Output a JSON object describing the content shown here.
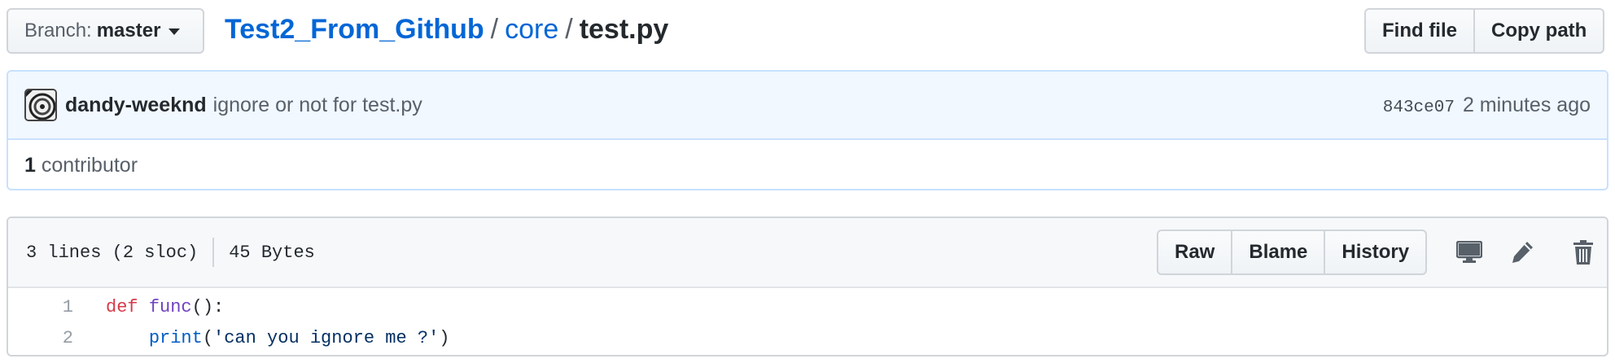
{
  "branch": {
    "prefix": "Branch:",
    "name": "master"
  },
  "breadcrumb": {
    "repo": "Test2_From_Github",
    "sep1": "/",
    "dir": "core",
    "sep2": "/",
    "file": "test.py"
  },
  "top_actions": {
    "find_file": "Find file",
    "copy_path": "Copy path"
  },
  "commit": {
    "author": "dandy-weeknd",
    "message": "ignore or not for test.py",
    "sha": "843ce07",
    "time": "2 minutes ago"
  },
  "contributors": {
    "count": "1",
    "label": "contributor"
  },
  "file": {
    "lines_info": "3 lines (2 sloc)",
    "size": "45 Bytes",
    "actions": {
      "raw": "Raw",
      "blame": "Blame",
      "history": "History"
    },
    "icons": [
      "desktop-icon",
      "pencil-icon",
      "trash-icon"
    ]
  },
  "code": {
    "lines": [
      {
        "num": "1",
        "tokens": [
          {
            "t": "def",
            "c": "kw"
          },
          {
            "t": " ",
            "c": ""
          },
          {
            "t": "func",
            "c": "fn"
          },
          {
            "t": "():",
            "c": ""
          }
        ]
      },
      {
        "num": "2",
        "tokens": [
          {
            "t": "    ",
            "c": ""
          },
          {
            "t": "print",
            "c": "bi"
          },
          {
            "t": "(",
            "c": ""
          },
          {
            "t": "'can you ignore me ?'",
            "c": "str"
          },
          {
            "t": ")",
            "c": ""
          }
        ]
      }
    ]
  },
  "colors": {
    "link": "#0366d6",
    "keyword": "#d73a49",
    "function": "#6f42c1",
    "builtin": "#005cc5",
    "commit_bg": "#f1f8ff"
  }
}
